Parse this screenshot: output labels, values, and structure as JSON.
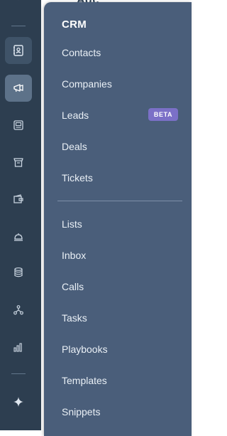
{
  "background_page": {
    "title_fragment": "Adc"
  },
  "rail": {
    "icons": [
      {
        "name": "contacts-book-icon"
      },
      {
        "name": "marketing-megaphone-icon"
      },
      {
        "name": "content-icon"
      },
      {
        "name": "commerce-icon"
      },
      {
        "name": "payments-wallet-icon"
      },
      {
        "name": "service-bell-icon"
      },
      {
        "name": "data-database-icon"
      },
      {
        "name": "automation-workflow-icon"
      },
      {
        "name": "reporting-bar-chart-icon"
      },
      {
        "name": "ai-sparkle-icon"
      }
    ]
  },
  "menu": {
    "heading": "CRM",
    "primary_items": [
      {
        "label": "Contacts"
      },
      {
        "label": "Companies"
      },
      {
        "label": "Leads",
        "badge": "BETA"
      },
      {
        "label": "Deals"
      },
      {
        "label": "Tickets"
      }
    ],
    "secondary_items": [
      {
        "label": "Lists"
      },
      {
        "label": "Inbox"
      },
      {
        "label": "Calls"
      },
      {
        "label": "Tasks"
      },
      {
        "label": "Playbooks"
      },
      {
        "label": "Templates"
      },
      {
        "label": "Snippets"
      }
    ]
  },
  "colors": {
    "rail": "#2d3e50",
    "flyout": "#4a5e7a",
    "badge": "#7b70c7"
  }
}
